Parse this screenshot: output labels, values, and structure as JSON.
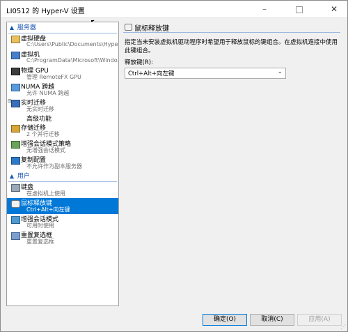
{
  "window": {
    "title": "LI0512 的 Hyper-V 设置",
    "controls": {
      "minimize": "–",
      "close": "✕"
    }
  },
  "sidebar": {
    "hardware_section": "服务器",
    "user_section": "用户",
    "hardware_items": [
      {
        "label": "虚拟硬盘",
        "sub": "C:\\Users\\Public\\Documents\\Hyper-...",
        "icon": "virtual-disk-icon"
      },
      {
        "label": "虚拟机",
        "sub": "C:\\ProgramData\\Microsoft\\Windo...",
        "icon": "virtual-machine-icon"
      },
      {
        "label": "物理 GPU",
        "sub": "管理 RemoteFX GPU",
        "icon": "gpu-icon"
      },
      {
        "label": "NUMA 跨越",
        "sub": "允许 NUMA 跨越",
        "icon": "numa-icon"
      },
      {
        "label": "实时迁移",
        "sub": "无实时迁移",
        "icon": "live-migration-icon"
      },
      {
        "label": "高级功能",
        "sub": "",
        "icon": ""
      },
      {
        "label": "存储迁移",
        "sub": "2 个并行迁移",
        "icon": "storage-migration-icon"
      },
      {
        "label": "增强会话模式策略",
        "sub": "无增强会话模式",
        "icon": "session-policy-icon"
      },
      {
        "label": "复制配置",
        "sub": "不允许作为副本服务器",
        "icon": "replication-icon"
      }
    ],
    "user_items": [
      {
        "label": "键盘",
        "sub": "在虚拟机上使用",
        "icon": "keyboard-icon"
      },
      {
        "label": "鼠标释放键",
        "sub": "Ctrl+Alt+向左键",
        "icon": "mouse-icon"
      },
      {
        "label": "增强会话模式",
        "sub": "可用时使用",
        "icon": "enhanced-session-icon"
      },
      {
        "label": "重置复选框",
        "sub": "重置复选框",
        "icon": "reset-icon"
      }
    ]
  },
  "content": {
    "header": "鼠标释放键",
    "description": "指定当未安装虚拟机驱动程序时希望用于释放鼠标的键组合。在虚拟机连接中使用此键组合。",
    "field_label": "释放键(R):",
    "selected_value": "Ctrl+Alt+向左键"
  },
  "buttons": {
    "ok": "确定(O)",
    "cancel": "取消(C)",
    "apply": "应用(A)"
  }
}
